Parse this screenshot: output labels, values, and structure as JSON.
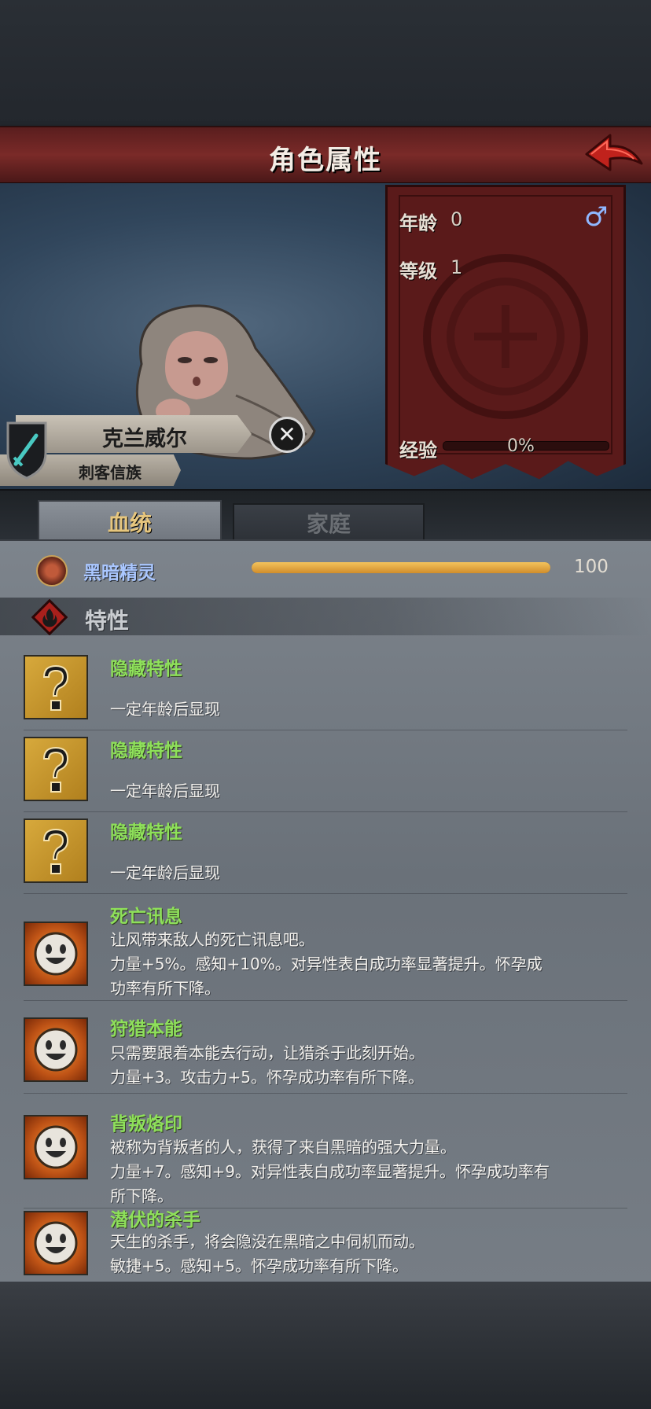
{
  "header": {
    "title": "角色属性",
    "back_icon": "red-back-arrow-icon"
  },
  "character": {
    "name": "克兰威尔",
    "tribe": "刺客信族",
    "age_label": "年龄",
    "age_value": "0",
    "gender_symbol": "♂",
    "level_label": "等级",
    "level_value": "1",
    "exp_label": "经验",
    "exp_value": "0%",
    "exp_fraction": 0.0
  },
  "tabs": [
    {
      "label": "血统",
      "active": true
    },
    {
      "label": "家庭",
      "active": false
    }
  ],
  "lineage": {
    "name": "黑暗精灵",
    "value": "100",
    "fraction": 1.0
  },
  "traits_section": {
    "title": "特性"
  },
  "traits": [
    {
      "name": "隐藏特性",
      "desc": "一定年龄后显现",
      "icon": "question-mark-icon"
    },
    {
      "name": "隐藏特性",
      "desc": "一定年龄后显现",
      "icon": "question-mark-icon"
    },
    {
      "name": "隐藏特性",
      "desc": "一定年龄后显现",
      "icon": "question-mark-icon"
    },
    {
      "name": "死亡讯息",
      "desc": "让风带来敌人的死亡讯息吧。\n力量+5%。感知+10%。对异性表白成功率显著提升。怀孕成功率有所下降。",
      "icon": "smiley-face-icon"
    },
    {
      "name": "狩猎本能",
      "desc": "只需要跟着本能去行动，让猎杀于此刻开始。\n力量+3。攻击力+5。怀孕成功率有所下降。",
      "icon": "smiley-face-icon"
    },
    {
      "name": "背叛烙印",
      "desc": "被称为背叛者的人，获得了来自黑暗的强大力量。\n力量+7。感知+9。对异性表白成功率显著提升。怀孕成功率有所下降。",
      "icon": "smiley-face-icon"
    },
    {
      "name": "潜伏的杀手",
      "desc": "天生的杀手，将会隐没在黑暗之中伺机而动。\n敏捷+5。感知+5。怀孕成功率有所下降。",
      "icon": "smiley-face-icon"
    }
  ]
}
